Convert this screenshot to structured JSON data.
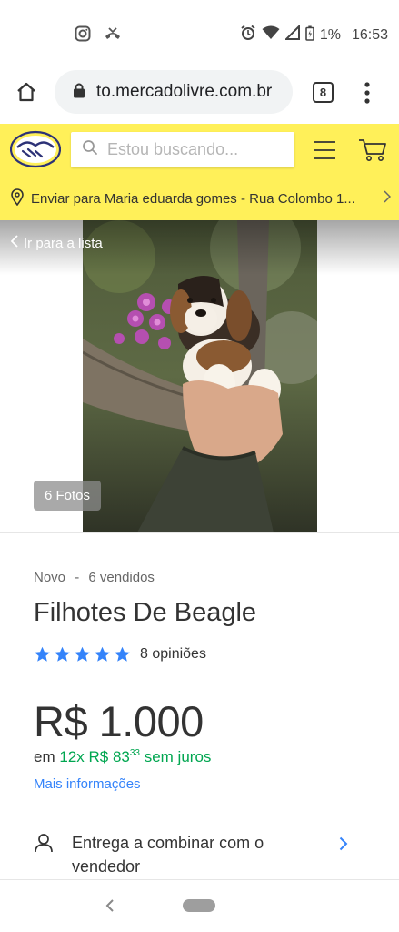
{
  "status_bar": {
    "battery": "1%",
    "time": "16:53"
  },
  "browser": {
    "url": "to.mercadolivre.com.br",
    "tab_count": "8"
  },
  "header": {
    "search_placeholder": "Estou buscando...",
    "delivery_text": "Enviar para Maria eduarda gomes - Rua Colombo 1..."
  },
  "gallery": {
    "back_label": "Ir para a lista",
    "photo_count": "6 Fotos"
  },
  "product": {
    "condition": "Novo",
    "separator": "-",
    "sold": "6 vendidos",
    "title": "Filhotes De Beagle",
    "rating_stars": 5,
    "reviews": "8 opiniões",
    "price": "R$ 1.000",
    "installment_prefix": "em",
    "installment_main": "12x R$ 83",
    "installment_cents": "33",
    "installment_suffix": "sem juros",
    "more_info": "Mais informações",
    "delivery_label": "Entrega a combinar com o vendedor"
  },
  "colors": {
    "brand_yellow": "#fff059",
    "link_blue": "#3483fa",
    "star_blue": "#3483fa",
    "green": "#00a650"
  }
}
